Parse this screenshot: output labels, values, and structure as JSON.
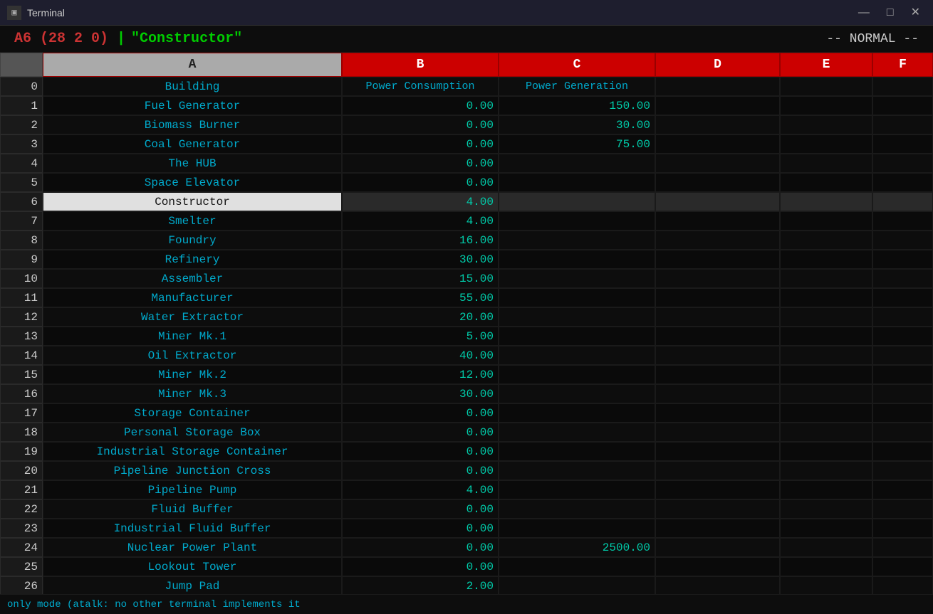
{
  "window": {
    "title": "Terminal",
    "icon": "▣",
    "controls": [
      "—",
      "□",
      "✕"
    ]
  },
  "status": {
    "cell_ref": "A6 (28 2 0)",
    "separator": "|",
    "cell_value": "\"Constructor\"",
    "mode": "-- NORMAL --"
  },
  "columns": {
    "row_num": "",
    "a": "A",
    "b": "B",
    "c": "C",
    "d": "D",
    "e": "E",
    "f": "F"
  },
  "rows": [
    {
      "num": "0",
      "a": "Building",
      "b": "Power Consumption",
      "c": "Power Generation",
      "d": "",
      "e": "",
      "f": "",
      "a_class": "header-label",
      "b_class": "header-label",
      "c_class": "header-label"
    },
    {
      "num": "1",
      "a": "Fuel Generator",
      "b": "0.00",
      "c": "150.00",
      "d": "",
      "e": "",
      "f": ""
    },
    {
      "num": "2",
      "a": "Biomass Burner",
      "b": "0.00",
      "c": "30.00",
      "d": "",
      "e": "",
      "f": ""
    },
    {
      "num": "3",
      "a": "Coal Generator",
      "b": "0.00",
      "c": "75.00",
      "d": "",
      "e": "",
      "f": ""
    },
    {
      "num": "4",
      "a": "The HUB",
      "b": "0.00",
      "c": "",
      "d": "",
      "e": "",
      "f": ""
    },
    {
      "num": "5",
      "a": "Space Elevator",
      "b": "0.00",
      "c": "",
      "d": "",
      "e": "",
      "f": ""
    },
    {
      "num": "6",
      "a": "Constructor",
      "b": "4.00",
      "c": "",
      "d": "",
      "e": "",
      "f": "",
      "selected": true
    },
    {
      "num": "7",
      "a": "Smelter",
      "b": "4.00",
      "c": "",
      "d": "",
      "e": "",
      "f": ""
    },
    {
      "num": "8",
      "a": "Foundry",
      "b": "16.00",
      "c": "",
      "d": "",
      "e": "",
      "f": ""
    },
    {
      "num": "9",
      "a": "Refinery",
      "b": "30.00",
      "c": "",
      "d": "",
      "e": "",
      "f": ""
    },
    {
      "num": "10",
      "a": "Assembler",
      "b": "15.00",
      "c": "",
      "d": "",
      "e": "",
      "f": ""
    },
    {
      "num": "11",
      "a": "Manufacturer",
      "b": "55.00",
      "c": "",
      "d": "",
      "e": "",
      "f": ""
    },
    {
      "num": "12",
      "a": "Water Extractor",
      "b": "20.00",
      "c": "",
      "d": "",
      "e": "",
      "f": ""
    },
    {
      "num": "13",
      "a": "Miner Mk.1",
      "b": "5.00",
      "c": "",
      "d": "",
      "e": "",
      "f": ""
    },
    {
      "num": "14",
      "a": "Oil Extractor",
      "b": "40.00",
      "c": "",
      "d": "",
      "e": "",
      "f": ""
    },
    {
      "num": "15",
      "a": "Miner Mk.2",
      "b": "12.00",
      "c": "",
      "d": "",
      "e": "",
      "f": ""
    },
    {
      "num": "16",
      "a": "Miner Mk.3",
      "b": "30.00",
      "c": "",
      "d": "",
      "e": "",
      "f": ""
    },
    {
      "num": "17",
      "a": "Storage Container",
      "b": "0.00",
      "c": "",
      "d": "",
      "e": "",
      "f": ""
    },
    {
      "num": "18",
      "a": "Personal Storage Box",
      "b": "0.00",
      "c": "",
      "d": "",
      "e": "",
      "f": ""
    },
    {
      "num": "19",
      "a": "Industrial Storage Container",
      "b": "0.00",
      "c": "",
      "d": "",
      "e": "",
      "f": ""
    },
    {
      "num": "20",
      "a": "Pipeline Junction Cross",
      "b": "0.00",
      "c": "",
      "d": "",
      "e": "",
      "f": ""
    },
    {
      "num": "21",
      "a": "Pipeline Pump",
      "b": "4.00",
      "c": "",
      "d": "",
      "e": "",
      "f": ""
    },
    {
      "num": "22",
      "a": "Fluid Buffer",
      "b": "0.00",
      "c": "",
      "d": "",
      "e": "",
      "f": ""
    },
    {
      "num": "23",
      "a": "Industrial Fluid Buffer",
      "b": "0.00",
      "c": "",
      "d": "",
      "e": "",
      "f": ""
    },
    {
      "num": "24",
      "a": "Nuclear Power Plant",
      "b": "0.00",
      "c": "2500.00",
      "d": "",
      "e": "",
      "f": ""
    },
    {
      "num": "25",
      "a": "Lookout Tower",
      "b": "0.00",
      "c": "",
      "d": "",
      "e": "",
      "f": ""
    },
    {
      "num": "26",
      "a": "Jump Pad",
      "b": "2.00",
      "c": "",
      "d": "",
      "e": "",
      "f": ""
    }
  ],
  "bottom_bar": {
    "text": "only mode (atalk: no other terminal implements it"
  }
}
